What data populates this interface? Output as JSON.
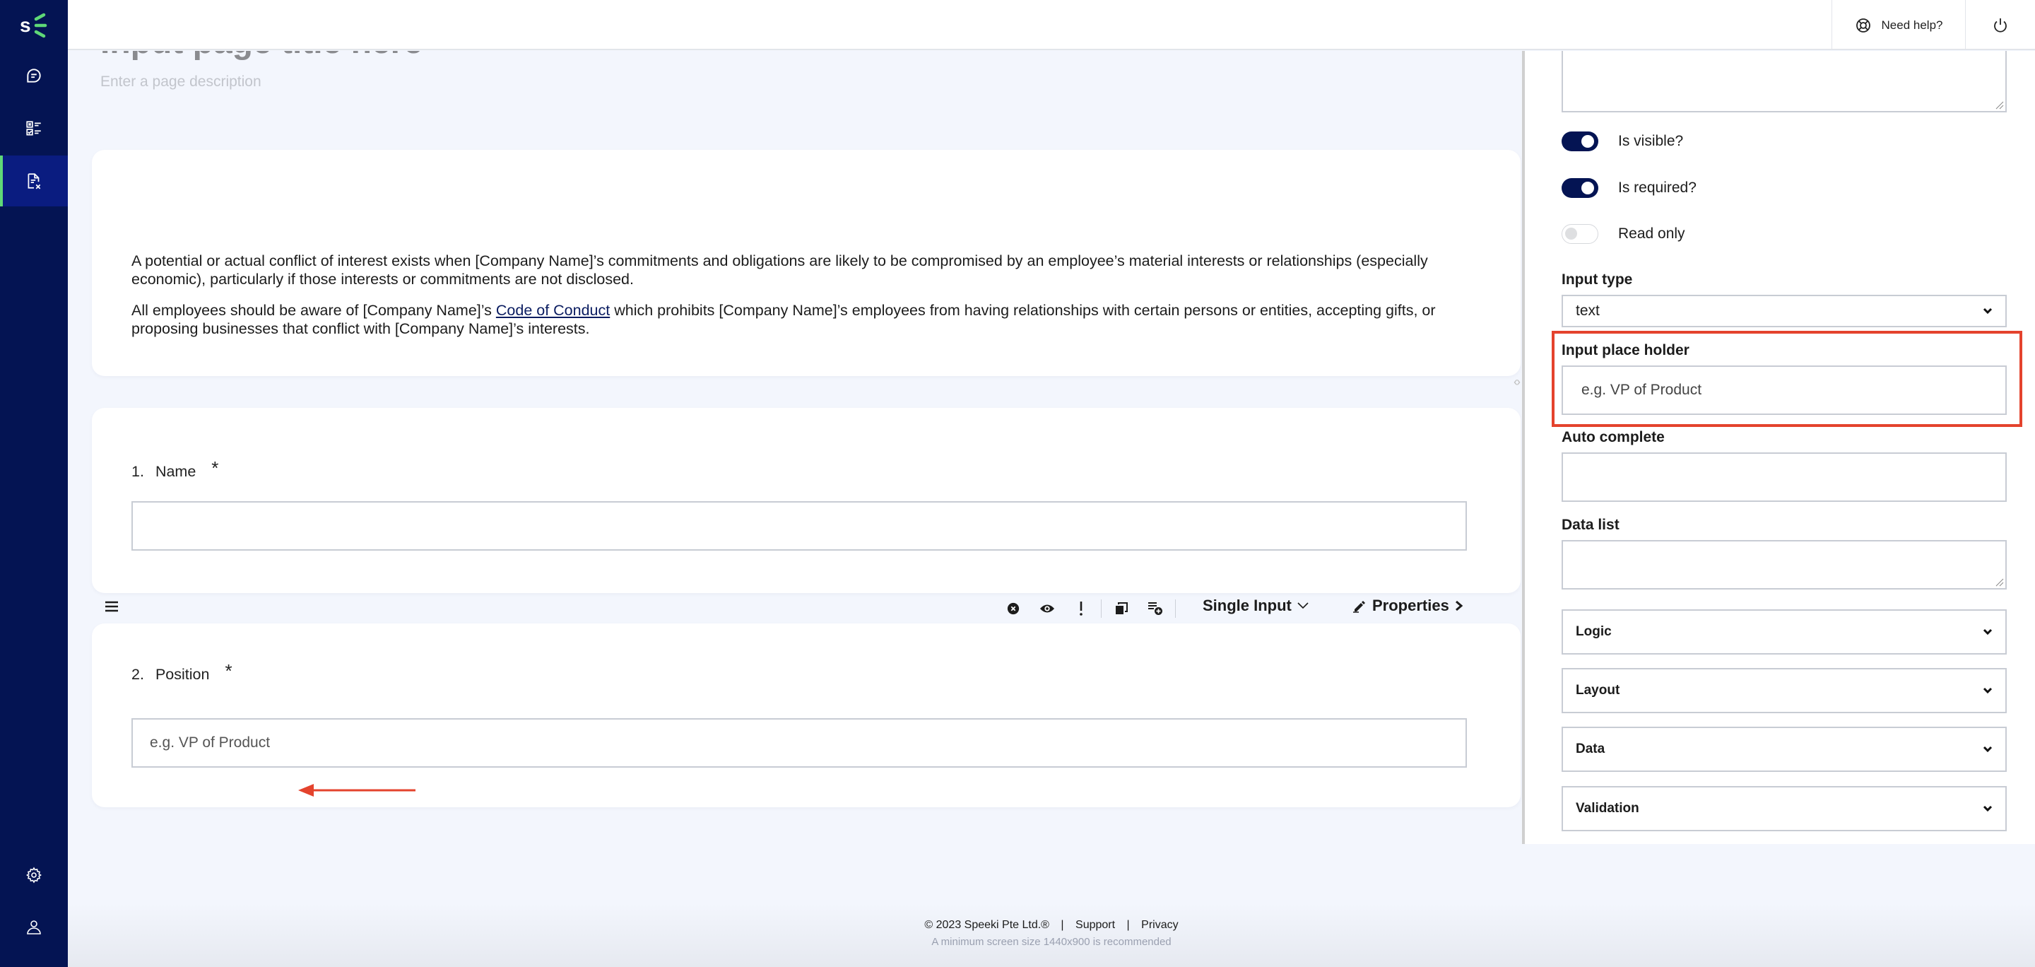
{
  "app": {
    "brand": "Speeki",
    "accent_color": "#041453",
    "highlight_color": "#e4432d",
    "active_indicator_color": "#5fd877"
  },
  "sidebar": {
    "items": [
      {
        "name": "chat",
        "icon": "chat-bubble-icon"
      },
      {
        "name": "checklist",
        "icon": "checklist-icon"
      },
      {
        "name": "forms",
        "icon": "document-x-icon",
        "active": true
      }
    ],
    "bottom_items": [
      {
        "name": "settings",
        "icon": "gear-icon"
      },
      {
        "name": "profile",
        "icon": "user-icon"
      }
    ]
  },
  "topbar": {
    "help_label": "Need help?",
    "help_icon": "lifebuoy-icon",
    "power_icon": "power-icon"
  },
  "page": {
    "title": "Input page title here",
    "description_placeholder": "Enter a page description"
  },
  "intro": {
    "p1": "A potential or actual conflict of interest exists when [Company Name]’s commitments and obligations are likely to be compromised by an employee’s material interests or relationships (especially economic), particularly if those interests or commitments are not disclosed.",
    "p2_before": "All employees should be aware of [Company Name]’s ",
    "p2_link": "Code of Conduct",
    "p2_after": " which prohibits [Company Name]’s employees from having relationships with certain persons or entities, accepting gifts, or proposing businesses that conflict with [Company Name]’s interests."
  },
  "questions": [
    {
      "number": "1.",
      "label": "Name",
      "required_mark": "*",
      "placeholder": ""
    },
    {
      "number": "2.",
      "label": "Position",
      "required_mark": "*",
      "placeholder": "e.g. VP of Product"
    }
  ],
  "question_toolbar": {
    "icons": [
      "delete-icon",
      "visibility-icon",
      "required-icon",
      "duplicate-icon",
      "add-after-icon"
    ],
    "type_label": "Single Input",
    "properties_label": "Properties"
  },
  "properties_panel": {
    "toggles": [
      {
        "label": "Is visible?",
        "on": true
      },
      {
        "label": "Is required?",
        "on": true
      },
      {
        "label": "Read only",
        "on": false
      }
    ],
    "input_type": {
      "label": "Input type",
      "value": "text"
    },
    "input_placeholder": {
      "label": "Input place holder",
      "value": "e.g. VP of Product"
    },
    "auto_complete": {
      "label": "Auto complete",
      "value": ""
    },
    "data_list": {
      "label": "Data list",
      "value": ""
    },
    "sections": [
      "Logic",
      "Layout",
      "Data",
      "Validation"
    ]
  },
  "footer": {
    "copyright": "© 2023 Speeki Pte Ltd.®",
    "support": "Support",
    "privacy": "Privacy",
    "separator": "|",
    "note": "A minimum screen size 1440x900 is recommended"
  }
}
